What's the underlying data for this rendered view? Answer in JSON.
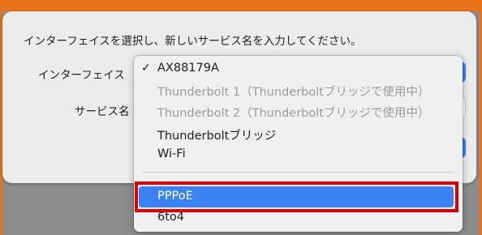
{
  "dialog": {
    "instruction": "インターフェイスを選択し、新しいサービス名を入力してください。",
    "interface_label": "インターフェイス",
    "service_name_label": "サービス名"
  },
  "menu": {
    "selected_check": "✓",
    "items": [
      {
        "label": "AX88179A",
        "checked": true,
        "disabled": false
      },
      {
        "label": "Thunderbolt 1（Thunderboltブリッジで使用中）",
        "checked": false,
        "disabled": true
      },
      {
        "label": "Thunderbolt 2（Thunderboltブリッジで使用中）",
        "checked": false,
        "disabled": true
      },
      {
        "label": "Thunderboltブリッジ",
        "checked": false,
        "disabled": false
      },
      {
        "label": "Wi-Fi",
        "checked": false,
        "disabled": false
      },
      {
        "label": "PPPoE",
        "checked": false,
        "disabled": false,
        "highlighted": true
      },
      {
        "label": "6to4",
        "checked": false,
        "disabled": false
      }
    ]
  },
  "colors": {
    "accent": "#3b82f6",
    "annotation": "#e00000",
    "frame": "#e8731a"
  }
}
